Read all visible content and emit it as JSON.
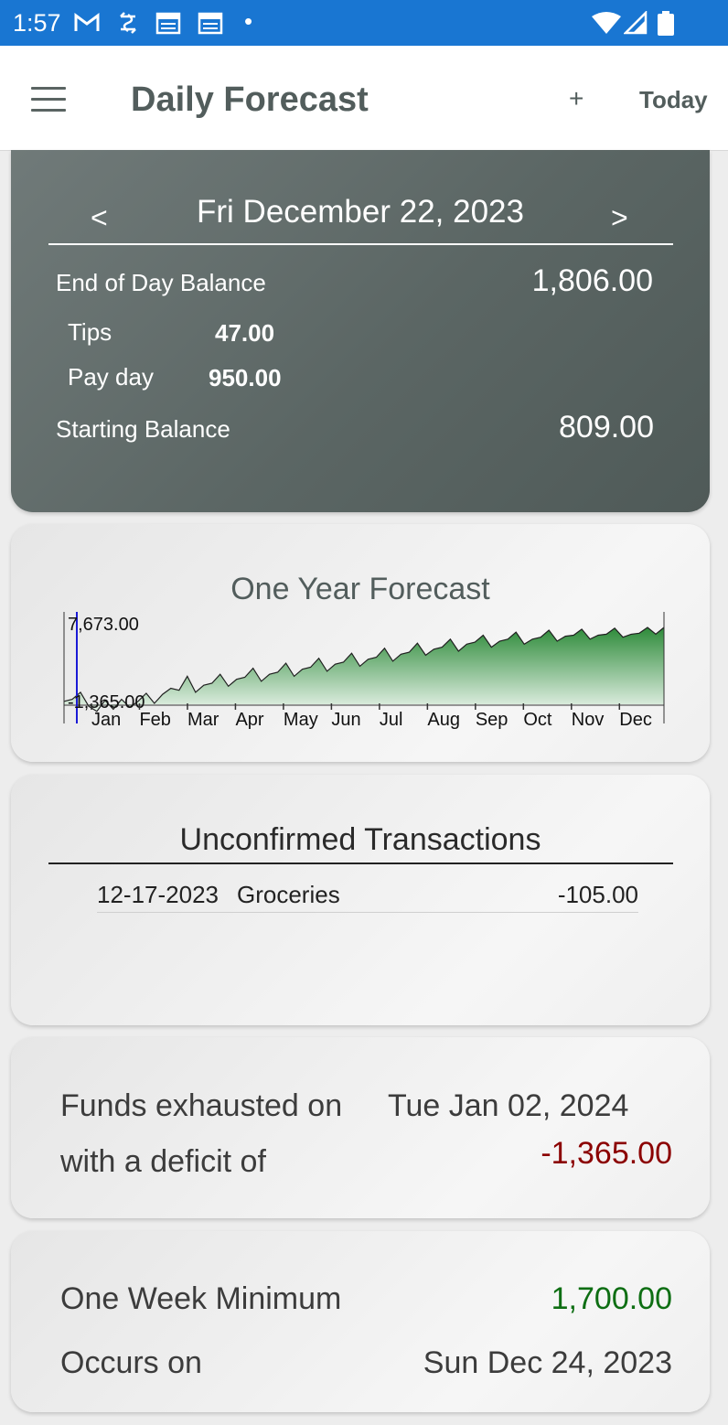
{
  "status_bar": {
    "time": "1:57",
    "icons": [
      "gmail-icon",
      "sync-icon",
      "calendar-icon",
      "calendar-icon",
      "dot-icon",
      "wifi-icon",
      "signal-icon",
      "battery-icon"
    ]
  },
  "app_bar": {
    "title": "Daily Forecast",
    "add_label": "+",
    "today_label": "Today",
    "menu_icon": "hamburger-menu-icon"
  },
  "balance": {
    "prev_label": "<",
    "next_label": ">",
    "date": "Fri December 22, 2023",
    "end_of_day_label": "End of Day Balance",
    "end_of_day_value": "1,806.00",
    "items": [
      {
        "label": "Tips",
        "value": "47.00"
      },
      {
        "label": "Pay day",
        "value": "950.00"
      }
    ],
    "starting_label": "Starting Balance",
    "starting_value": "809.00"
  },
  "forecast_chart": {
    "title": "One Year Forecast"
  },
  "chart_data": {
    "type": "area",
    "title": "One Year Forecast",
    "xlabel": "",
    "ylabel": "",
    "y_tick_labels": [
      "7,673.00",
      "-1,365.00"
    ],
    "x_tick_labels": [
      "Jan",
      "Feb",
      "Mar",
      "Apr",
      "May",
      "Jun",
      "Jul",
      "Aug",
      "Sep",
      "Oct",
      "Nov",
      "Dec"
    ],
    "ylim": [
      -1365,
      7673
    ],
    "series": [
      {
        "x": [
          0,
          5,
          10,
          15,
          20,
          25,
          30,
          35,
          40,
          45,
          50,
          55,
          60,
          65,
          70,
          75,
          80,
          85,
          90,
          95,
          100,
          105,
          110,
          115,
          120,
          125,
          130,
          135,
          140,
          145,
          150,
          155,
          160,
          165,
          170,
          175,
          180,
          185,
          190,
          195,
          200,
          205,
          210,
          215,
          220,
          225,
          230,
          235,
          240,
          245,
          250,
          255,
          260,
          265,
          270,
          275,
          280,
          285,
          290,
          295,
          300,
          305,
          310,
          315,
          320,
          325,
          330,
          335,
          340,
          345,
          350,
          355,
          360,
          365
        ],
        "values": [
          300,
          500,
          1200,
          -200,
          -700,
          400,
          -500,
          500,
          -300,
          300,
          1100,
          100,
          1000,
          1600,
          1400,
          2800,
          1200,
          1900,
          2100,
          3000,
          1800,
          2500,
          2700,
          3600,
          2300,
          3000,
          3200,
          4100,
          2800,
          3500,
          3700,
          4600,
          3300,
          4000,
          4200,
          5100,
          3800,
          4500,
          4700,
          5600,
          4300,
          5000,
          5200,
          6100,
          4900,
          5500,
          5700,
          6500,
          5300,
          6000,
          6200,
          6900,
          5700,
          6300,
          6500,
          7200,
          6000,
          6500,
          6700,
          7400,
          6300,
          6800,
          6900,
          7500,
          6500,
          6900,
          7000,
          7600,
          6700,
          7000,
          7100,
          7673,
          7000,
          7673
        ]
      }
    ],
    "current_marker_x": 0,
    "colors": {
      "fill_top": "#2e8b3a",
      "fill_bottom": "#e8f3ea",
      "line": "#1f1f1f",
      "marker": "#1a1ad6"
    }
  },
  "unconfirmed": {
    "title": "Unconfirmed Transactions",
    "transactions": [
      {
        "date": "12-17-2023",
        "description": "Groceries",
        "amount": "-105.00"
      }
    ]
  },
  "funds": {
    "label_line1": "Funds exhausted on",
    "date": "Tue Jan 02, 2024",
    "label_line2": "with a deficit of",
    "deficit": "-1,365.00"
  },
  "week_min": {
    "label": "One Week Minimum",
    "value": "1,700.00",
    "occurs_label": "Occurs on",
    "occurs_date": "Sun Dec 24, 2023"
  }
}
